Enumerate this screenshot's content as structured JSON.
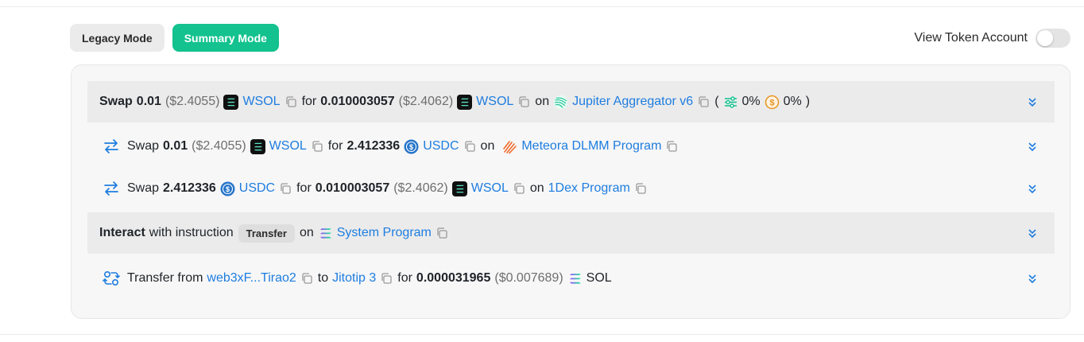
{
  "modes": {
    "legacy": "Legacy Mode",
    "summary": "Summary Mode",
    "active": "summary"
  },
  "view_token": {
    "label": "View Token Account",
    "enabled": false
  },
  "colors": {
    "accent": "#13c28e",
    "link": "#1e7de0"
  },
  "rows": [
    {
      "verb": "Swap",
      "amount_in": "0.01",
      "usd_in": "($2.4055)",
      "token_in": "WSOL",
      "for": "for",
      "amount_out": "0.010003057",
      "usd_out": "($2.4062)",
      "token_out": "WSOL",
      "on": "on",
      "program": "Jupiter Aggregator v6",
      "paren_open": "(",
      "fee1": "0%",
      "fee2": "0%",
      "paren_close": ")"
    },
    {
      "verb": "Swap",
      "amount_in": "0.01",
      "usd_in": "($2.4055)",
      "token_in": "WSOL",
      "for": "for",
      "amount_out": "2.412336",
      "token_out": "USDC",
      "on": "on",
      "program": "Meteora DLMM Program"
    },
    {
      "verb": "Swap",
      "amount_in": "2.412336",
      "token_in": "USDC",
      "for": "for",
      "amount_out": "0.010003057",
      "usd_out": "($2.4062)",
      "token_out": "WSOL",
      "on": "on",
      "program": "1Dex Program"
    },
    {
      "verb": "Interact",
      "with": "with instruction",
      "instruction": "Transfer",
      "on": "on",
      "program": "System Program"
    },
    {
      "verb": "Transfer from",
      "from": "web3xF...Tirao2",
      "to": "to",
      "recipient": "Jitotip 3",
      "for": "for",
      "amount": "0.000031965",
      "usd": "($0.007689)",
      "token": "SOL"
    }
  ]
}
